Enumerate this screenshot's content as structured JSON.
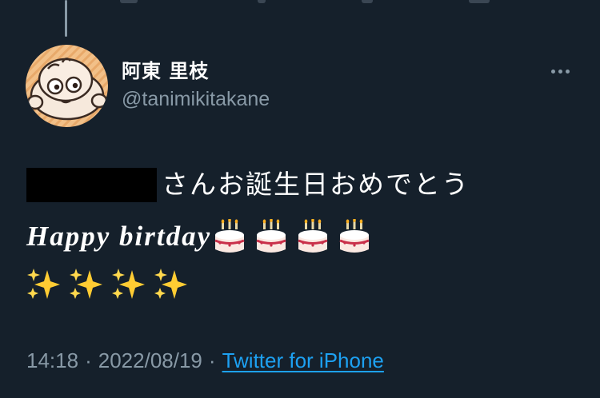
{
  "tweet": {
    "author": {
      "display_name": "阿東 里枝",
      "handle": "@tanimikitakane",
      "avatar_icon": "cartoon-face-avatar"
    },
    "text_line1": "さんお誕生日おめでとう",
    "text_line2": "Happy birtday",
    "cake_emoji_count": 4,
    "sparkle_emoji_count": 4,
    "time": "14:18",
    "date": "2022/08/19",
    "separator": "·",
    "source": "Twitter for iPhone"
  },
  "colors": {
    "background": "#15202b",
    "secondary_text": "#8899a6",
    "link": "#1da1f2",
    "redaction": "#000000"
  },
  "icons": [
    "more-options-icon",
    "birthday-cake-icon",
    "sparkles-icon"
  ]
}
